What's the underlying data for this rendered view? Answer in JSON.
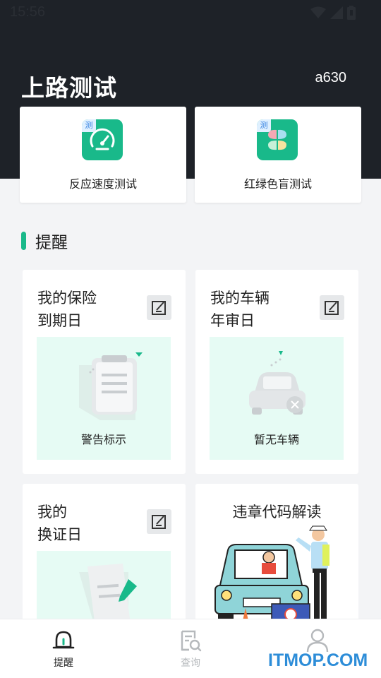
{
  "status_bar": {
    "time": "15:56",
    "icons": [
      "wifi-icon",
      "signal-icon",
      "battery-icon"
    ]
  },
  "header": {
    "title": "上路测试",
    "user_id": "a630",
    "background": "#1e2228"
  },
  "tests": [
    {
      "label": "反应速度测试",
      "badge": "测",
      "icon": "speedometer-icon"
    },
    {
      "label": "红绿色盲测试",
      "badge": "测",
      "icon": "color-petals-icon"
    }
  ],
  "reminders_section": {
    "title": "提醒"
  },
  "reminders": [
    {
      "title_line1": "我的保险",
      "title_line2": "到期日",
      "caption": "警告标示",
      "illustration": "clipboard-illustration"
    },
    {
      "title_line1": "我的车辆",
      "title_line2": "年审日",
      "caption": "暂无车辆",
      "illustration": "car-empty-illustration"
    },
    {
      "title_line1": "我的",
      "title_line2": "换证日",
      "illustration": "document-pen-illustration"
    },
    {
      "title": "违章代码解读",
      "illustration": "traffic-police-illustration"
    }
  ],
  "bottom_nav": [
    {
      "label": "提醒",
      "icon": "bell-icon",
      "active": true
    },
    {
      "label": "查询",
      "icon": "search-document-icon",
      "active": false
    },
    {
      "label": "",
      "icon": "user-icon",
      "active": false
    }
  ],
  "watermark": "ITMOP.COM",
  "colors": {
    "accent": "#19b98a",
    "illustration_bg": "#e6fbf4",
    "watermark": "#2d8dd8"
  }
}
